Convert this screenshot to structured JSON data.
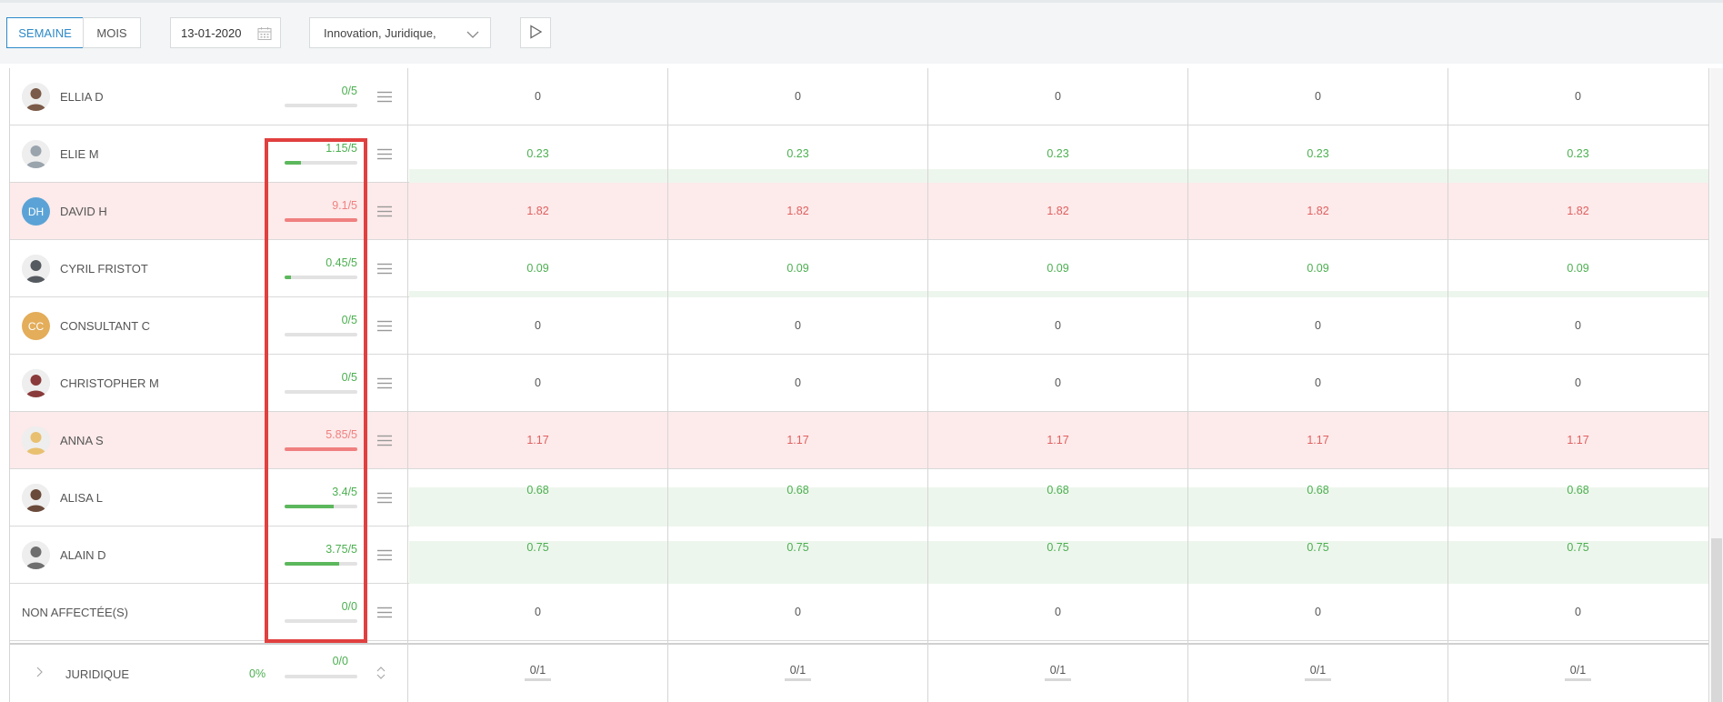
{
  "toolbar": {
    "view_week": "SEMAINE",
    "view_month": "MOIS",
    "date": "13-01-2020",
    "filter": "Innovation, Juridique,"
  },
  "icons": {
    "calendar": "calendar-icon",
    "dropdown": "chevron-down-icon",
    "play": "play-icon",
    "menu": "hamburger-menu-icon",
    "expand": "chevron-right-icon",
    "sort": "sort-icon"
  },
  "colors": {
    "accent": "#2d8ac9",
    "ok_green": "#4caf50",
    "over_red": "#e05f5f",
    "over_row_bg": "#fdeaea",
    "green_band": "#edf6ed",
    "highlight_box": "#e0403f"
  },
  "rows": [
    {
      "name": "ELLIA D",
      "avatar": "photo",
      "avatar_color": "#7a5a48",
      "ratio": "0/5",
      "load_pct": 0,
      "status": "ok",
      "values": [
        "0",
        "0",
        "0",
        "0",
        "0"
      ],
      "value_color": "normal"
    },
    {
      "name": "ELIE M",
      "avatar": "photo",
      "avatar_color": "#9aa4ad",
      "ratio": "1.15/5",
      "load_pct": 23,
      "status": "ok",
      "values": [
        "0.23",
        "0.23",
        "0.23",
        "0.23",
        "0.23"
      ],
      "value_color": "green"
    },
    {
      "name": "DAVID H",
      "avatar": "DH",
      "avatar_color": "#5ba3d6",
      "ratio": "9.1/5",
      "load_pct": 100,
      "status": "over",
      "values": [
        "1.82",
        "1.82",
        "1.82",
        "1.82",
        "1.82"
      ],
      "value_color": "red"
    },
    {
      "name": "CYRIL FRISTOT",
      "avatar": "photo",
      "avatar_color": "#555a60",
      "ratio": "0.45/5",
      "load_pct": 9,
      "status": "ok",
      "values": [
        "0.09",
        "0.09",
        "0.09",
        "0.09",
        "0.09"
      ],
      "value_color": "green"
    },
    {
      "name": "CONSULTANT C",
      "avatar": "CC",
      "avatar_color": "#e3ad5a",
      "ratio": "0/5",
      "load_pct": 0,
      "status": "ok",
      "values": [
        "0",
        "0",
        "0",
        "0",
        "0"
      ],
      "value_color": "normal"
    },
    {
      "name": "CHRISTOPHER M",
      "avatar": "photo",
      "avatar_color": "#8a3a3a",
      "ratio": "0/5",
      "load_pct": 0,
      "status": "ok",
      "values": [
        "0",
        "0",
        "0",
        "0",
        "0"
      ],
      "value_color": "normal"
    },
    {
      "name": "ANNA S",
      "avatar": "photo",
      "avatar_color": "#e8c070",
      "ratio": "5.85/5",
      "load_pct": 100,
      "status": "over",
      "values": [
        "1.17",
        "1.17",
        "1.17",
        "1.17",
        "1.17"
      ],
      "value_color": "red"
    },
    {
      "name": "ALISA L",
      "avatar": "photo",
      "avatar_color": "#6a4a3a",
      "ratio": "3.4/5",
      "load_pct": 68,
      "status": "ok",
      "values": [
        "0.68",
        "0.68",
        "0.68",
        "0.68",
        "0.68"
      ],
      "value_color": "green"
    },
    {
      "name": "ALAIN D",
      "avatar": "photo",
      "avatar_color": "#6f6f6f",
      "ratio": "3.75/5",
      "load_pct": 75,
      "status": "ok",
      "values": [
        "0.75",
        "0.75",
        "0.75",
        "0.75",
        "0.75"
      ],
      "value_color": "green"
    },
    {
      "name": "NON AFFECTÉE(S)",
      "avatar": "",
      "avatar_color": "",
      "ratio": "0/0",
      "load_pct": 0,
      "status": "ok",
      "values": [
        "0",
        "0",
        "0",
        "0",
        "0"
      ],
      "value_color": "normal"
    }
  ],
  "footer": {
    "label": "JURIDIQUE",
    "percent": "0%",
    "ratio": "0/0",
    "load_pct": 0,
    "values": [
      "0/1",
      "0/1",
      "0/1",
      "0/1",
      "0/1"
    ]
  }
}
